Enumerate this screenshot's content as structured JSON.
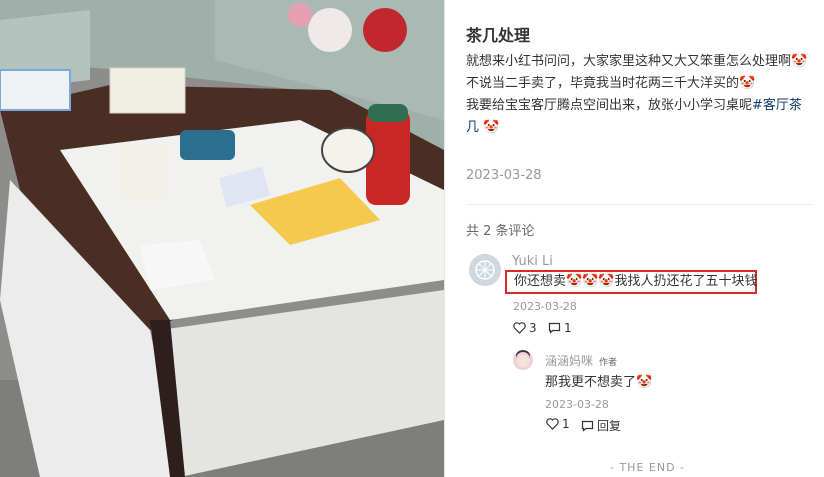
{
  "post": {
    "title": "茶几处理",
    "lines": [
      "就想来小红书问问，大家家里这种又大又笨重怎么处理啊🤡",
      "不说当二手卖了，毕竟我当时花两三千大洋买的🤡"
    ],
    "line3_prefix": "我要给宝宝客厅腾点空间出来，放张小小学习桌呢",
    "hashtag": "#客厅茶几",
    "line3_suffix": " 🤡",
    "date": "2023-03-28"
  },
  "comments": {
    "count_label": "共 2 条评论",
    "items": [
      {
        "user": "Yuki Li",
        "text": "你还想卖🤡🤡🤡我找人扔还花了五十块钱",
        "date": "2023-03-28",
        "likes": "3",
        "replies": "1"
      }
    ],
    "reply": {
      "user": "涵涵妈咪",
      "badge": "作者",
      "text": "那我更不想卖了🤡",
      "date": "2023-03-28",
      "likes": "1",
      "reply_label": "回复"
    }
  },
  "footer": {
    "end_label": "- THE END -"
  },
  "photo": {
    "description_icon": "coffee-table-photo"
  }
}
